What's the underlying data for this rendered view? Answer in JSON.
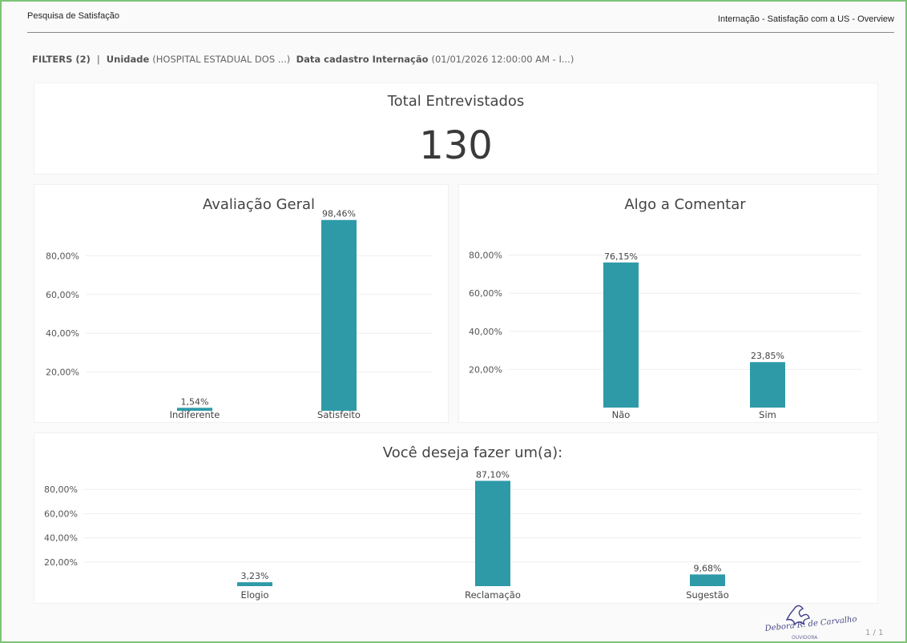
{
  "header": {
    "left_title": "Pesquisa de Satisfação",
    "right_title": "Internação - Satisfação com a US - Overview"
  },
  "filters": {
    "label": "FILTERS (2)",
    "separator": "|",
    "unidade_label": "Unidade",
    "unidade_value": "(HOSPITAL ESTADUAL DOS ...)",
    "data_label": "Data cadastro Internação",
    "data_value": "(01/01/2026 12:00:00 AM - I...)"
  },
  "total": {
    "title": "Total Entrevistados",
    "value": "130"
  },
  "chart_data": [
    {
      "type": "bar",
      "title": "Avaliação Geral",
      "categories": [
        "Indiferente",
        "Satisfeito"
      ],
      "values": [
        1.54,
        98.46
      ],
      "value_labels": [
        "1,54%",
        "98,46%"
      ],
      "yticks": [
        "20,00%",
        "40,00%",
        "60,00%",
        "80,00%"
      ],
      "ylim": [
        0,
        100
      ],
      "grid": true,
      "bar_color": "#2e9aa8"
    },
    {
      "type": "bar",
      "title": "Algo a Comentar",
      "categories": [
        "Não",
        "Sim"
      ],
      "values": [
        76.15,
        23.85
      ],
      "value_labels": [
        "76,15%",
        "23,85%"
      ],
      "yticks": [
        "20,00%",
        "40,00%",
        "60,00%",
        "80,00%"
      ],
      "ylim": [
        0,
        100
      ],
      "grid": true,
      "bar_color": "#2e9aa8"
    },
    {
      "type": "bar",
      "title": "Você deseja fazer um(a):",
      "categories": [
        "Elogio",
        "Reclamação",
        "Sugestão"
      ],
      "values": [
        3.23,
        87.1,
        9.68
      ],
      "value_labels": [
        "3,23%",
        "87,10%",
        "9,68%"
      ],
      "yticks": [
        "20,00%",
        "40,00%",
        "60,00%",
        "80,00%"
      ],
      "ylim": [
        0,
        100
      ],
      "grid": true,
      "bar_color": "#2e9aa8"
    }
  ],
  "footer": {
    "signature_name": "Debora R. de Carvalho",
    "signature_role": "OUVIDORA",
    "page": "1 / 1"
  }
}
